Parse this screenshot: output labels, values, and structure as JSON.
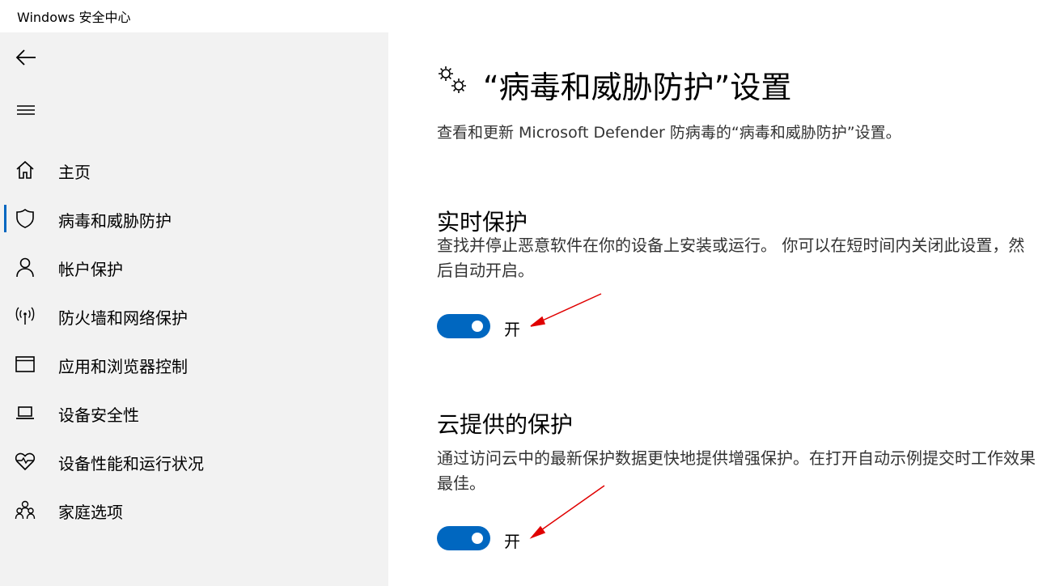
{
  "window": {
    "title": "Windows 安全中心"
  },
  "sidebar": {
    "items": [
      {
        "label": "主页",
        "icon": "home-icon"
      },
      {
        "label": "病毒和威胁防护",
        "icon": "shield-icon",
        "active": true
      },
      {
        "label": "帐户保护",
        "icon": "person-icon"
      },
      {
        "label": "防火墙和网络保护",
        "icon": "wifi-antenna-icon"
      },
      {
        "label": "应用和浏览器控制",
        "icon": "app-window-icon"
      },
      {
        "label": "设备安全性",
        "icon": "laptop-icon"
      },
      {
        "label": "设备性能和运行状况",
        "icon": "heart-pulse-icon"
      },
      {
        "label": "家庭选项",
        "icon": "family-icon"
      }
    ]
  },
  "main": {
    "title": "“病毒和威胁防护”设置",
    "description": "查看和更新 Microsoft Defender 防病毒的“病毒和威胁防护”设置。",
    "sections": [
      {
        "title": "实时保护",
        "description": "查找并停止恶意软件在你的设备上安装或运行。 你可以在短时间内关闭此设置，然后自动开启。",
        "toggle": {
          "on": true,
          "label": "开"
        }
      },
      {
        "title": "云提供的保护",
        "description": "通过访问云中的最新保护数据更快地提供增强保护。在打开自动示例提交时工作效果最佳。",
        "toggle": {
          "on": true,
          "label": "开"
        }
      }
    ]
  },
  "colors": {
    "accent": "#0067c0",
    "sidebar_bg": "#f2f2f2",
    "annotation": "#e00000"
  }
}
